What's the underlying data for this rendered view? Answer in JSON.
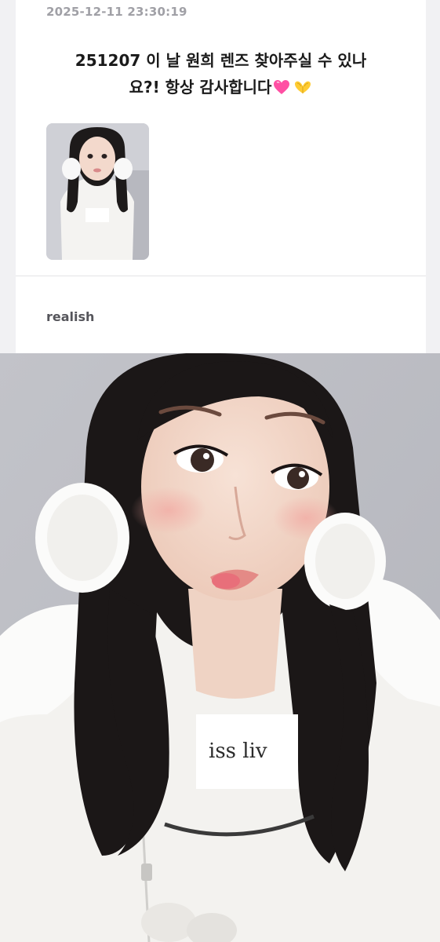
{
  "post": {
    "timestamp": "2025-12-11 23:30:19",
    "question_line1": "251207 이 날 원희 렌즈 찾아주실 수 있나",
    "question_line2": "요?! 항상 감사합니다",
    "thumbnail_icon": "photo-thumbnail"
  },
  "answer": {
    "author": "realish"
  },
  "main_image": {
    "icon": "selfie-photo",
    "shirt_text": "iss liv"
  },
  "colors": {
    "heart": "#ff4fa3",
    "hands": "#ffcc33"
  }
}
